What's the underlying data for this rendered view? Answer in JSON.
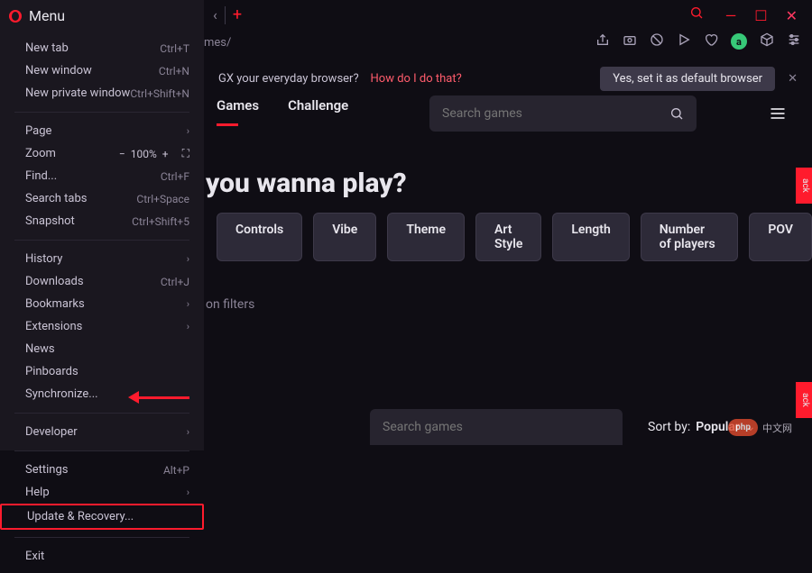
{
  "menu": {
    "title": "Menu",
    "groups": [
      [
        {
          "label": "New tab",
          "shortcut": "Ctrl+T"
        },
        {
          "label": "New window",
          "shortcut": "Ctrl+N"
        },
        {
          "label": "New private window",
          "shortcut": "Ctrl+Shift+N"
        }
      ],
      [
        {
          "label": "Page",
          "submenu": true
        },
        {
          "label": "Zoom",
          "zoom": true,
          "value": "100%"
        },
        {
          "label": "Find...",
          "shortcut": "Ctrl+F"
        },
        {
          "label": "Search tabs",
          "shortcut": "Ctrl+Space"
        },
        {
          "label": "Snapshot",
          "shortcut": "Ctrl+Shift+5"
        }
      ],
      [
        {
          "label": "History",
          "submenu": true
        },
        {
          "label": "Downloads",
          "shortcut": "Ctrl+J"
        },
        {
          "label": "Bookmarks",
          "submenu": true
        },
        {
          "label": "Extensions",
          "submenu": true
        },
        {
          "label": "News"
        },
        {
          "label": "Pinboards"
        },
        {
          "label": "Synchronize..."
        }
      ],
      [
        {
          "label": "Developer",
          "submenu": true
        }
      ],
      [
        {
          "label": "Settings",
          "shortcut": "Alt+P"
        },
        {
          "label": "Help",
          "submenu": true
        },
        {
          "label": "Update & Recovery...",
          "highlight": true
        }
      ],
      [
        {
          "label": "Exit"
        }
      ]
    ]
  },
  "url_fragment": "mes/",
  "prompt": {
    "text": "GX your everyday browser?",
    "link": "How do I do that?",
    "button": "Yes, set it as default browser"
  },
  "nav": {
    "tabs": [
      "Games",
      "Challenge"
    ],
    "active": 0
  },
  "search_placeholder": "Search games",
  "headline": "you wanna play?",
  "chips": [
    "Controls",
    "Vibe",
    "Theme",
    "Art Style",
    "Length",
    "Number of players",
    "POV"
  ],
  "filters_text": "on filters",
  "bottom_search_placeholder": "Search games",
  "sort": {
    "label": "Sort by:",
    "value": "Popular"
  },
  "feedback_label": "ack",
  "avatar_letter": "a",
  "watermark": {
    "badge": "php",
    "text": "中文网"
  }
}
